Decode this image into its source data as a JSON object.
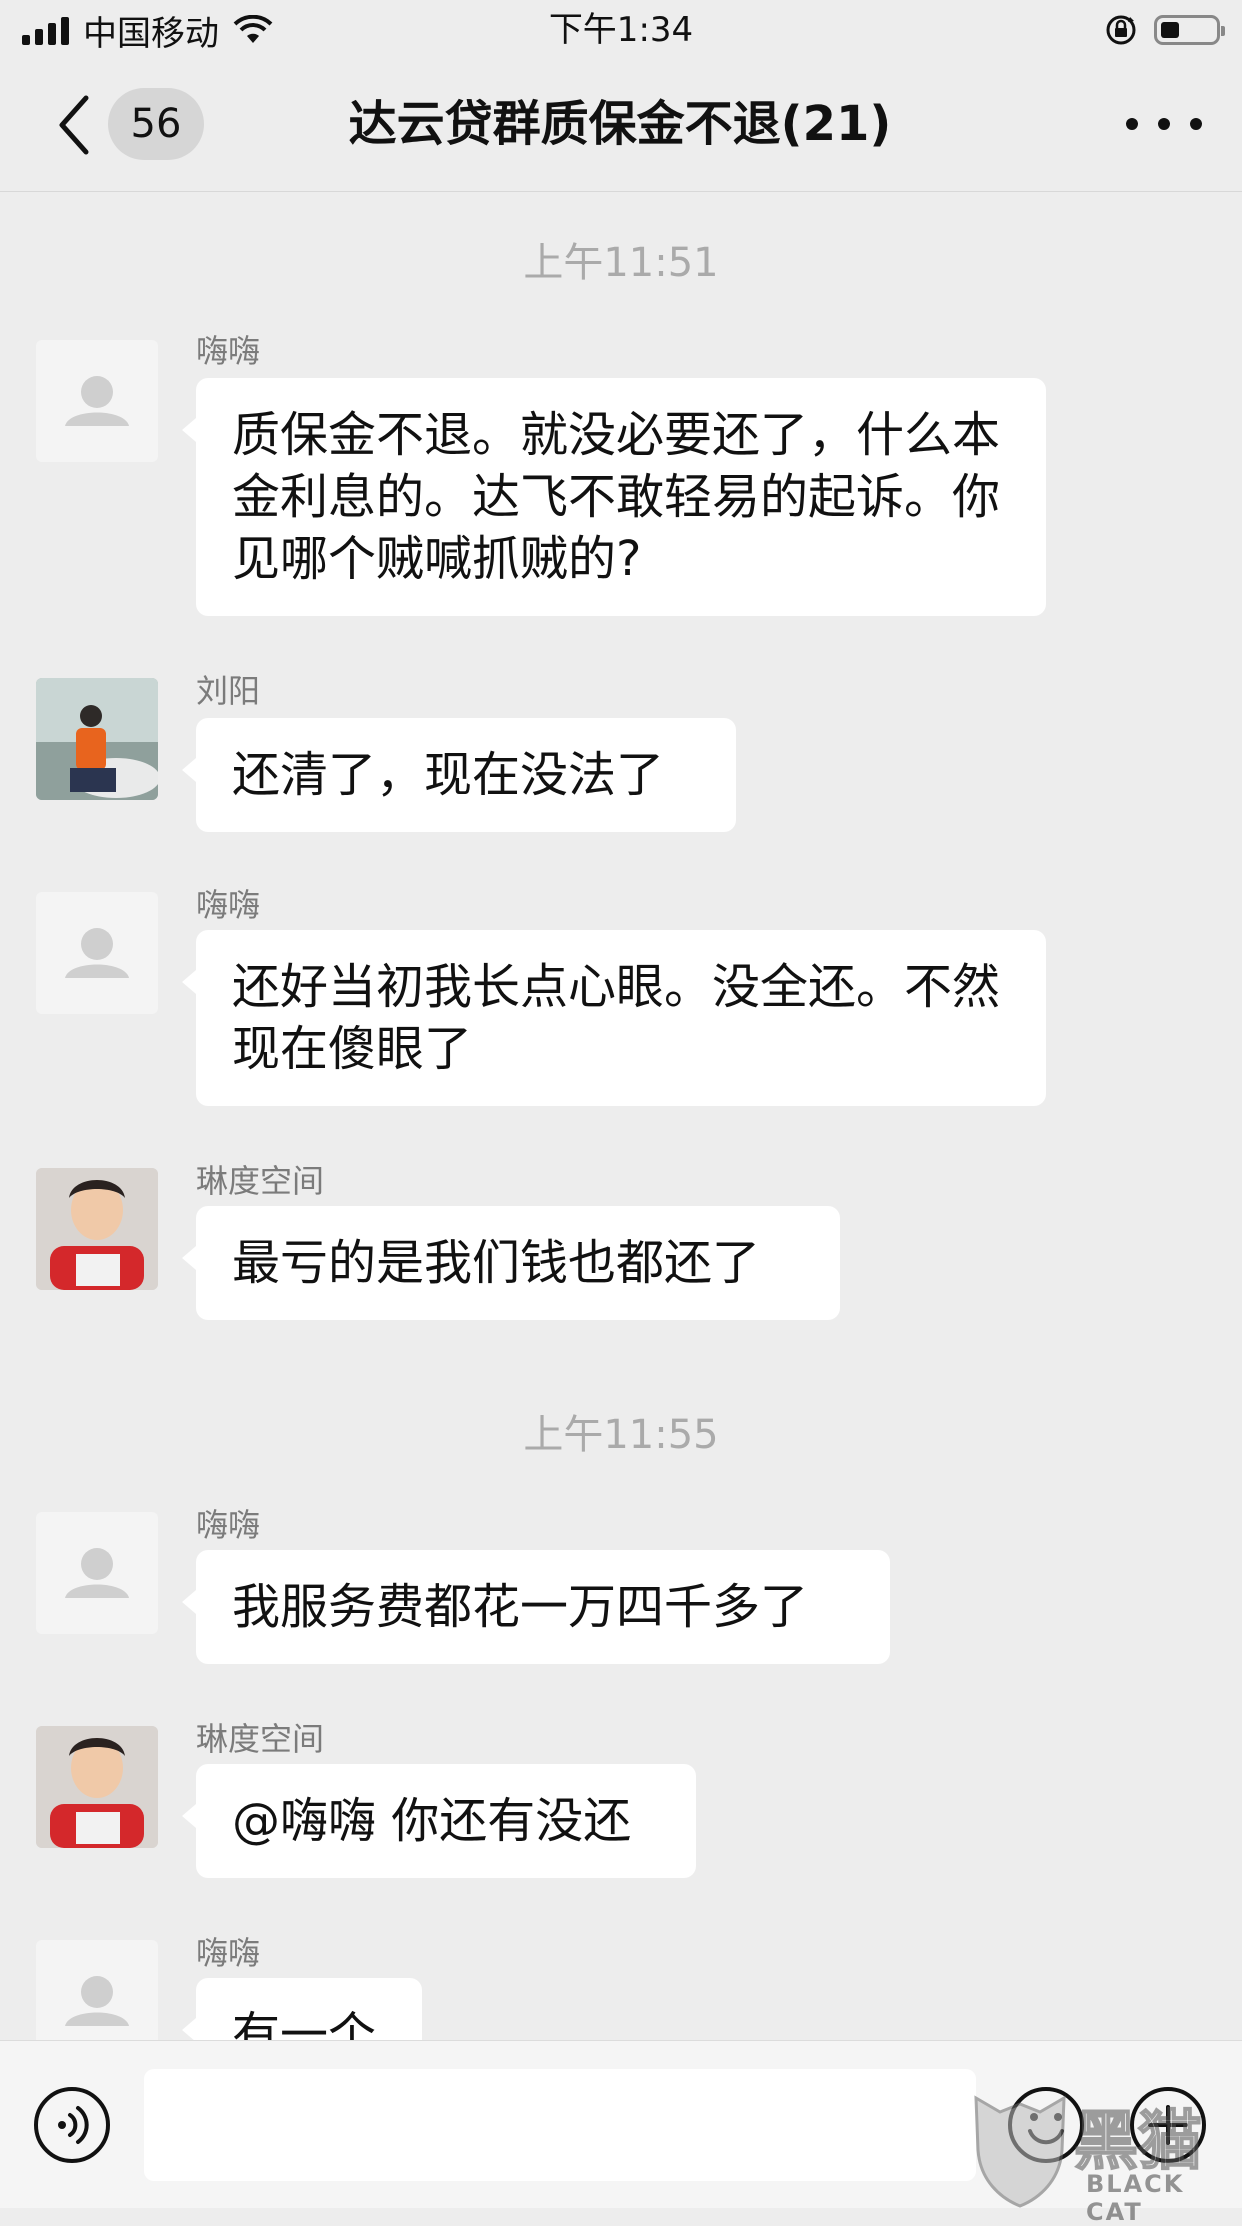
{
  "status_bar": {
    "carrier": "中国移动",
    "time": "下午1:34"
  },
  "nav": {
    "unread_count": "56",
    "title": "达云贷群质保金不退(21)"
  },
  "chat": {
    "timestamps": [
      "上午11:51",
      "上午11:55"
    ],
    "messages": [
      {
        "sender": "嗨嗨",
        "text": "质保金不退。就没必要还了，什么本金利息的。达飞不敢轻易的起诉。你见哪个贼喊抓贼的?"
      },
      {
        "sender": "刘阳",
        "text": "还清了，现在没法了"
      },
      {
        "sender": "嗨嗨",
        "text": "还好当初我长点心眼。没全还。不然现在傻眼了"
      },
      {
        "sender": "琳度空间",
        "text": "最亏的是我们钱也都还了"
      },
      {
        "sender": "嗨嗨",
        "text": "我服务费都花一万四千多了"
      },
      {
        "sender": "琳度空间",
        "text": "@嗨嗨 你还有没还"
      },
      {
        "sender": "嗨嗨",
        "text": "有一个"
      }
    ]
  },
  "input_bar": {
    "placeholder": ""
  },
  "watermark": {
    "cn": "黑猫",
    "en": "BLACK CAT"
  },
  "colors": {
    "background": "#ededed",
    "bubble": "#ffffff",
    "sender_name": "#7b7b7b",
    "timestamp": "#aaaaaa"
  }
}
